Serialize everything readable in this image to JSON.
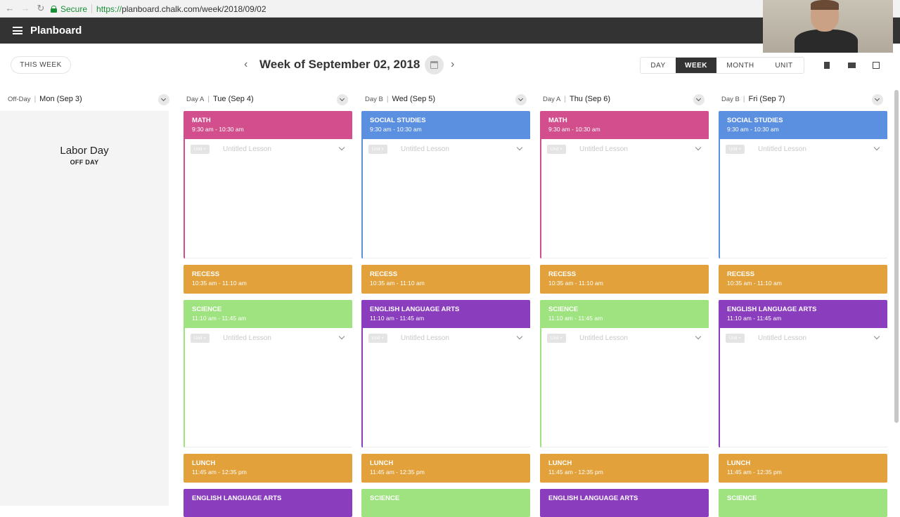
{
  "browser": {
    "secure_label": "Secure",
    "url_protocol": "https://",
    "url_rest": "planboard.chalk.com/week/2018/09/02"
  },
  "app": {
    "name": "Planboard"
  },
  "toolbar": {
    "this_week": "THIS WEEK",
    "title": "Week of September 02, 2018",
    "views": [
      "DAY",
      "WEEK",
      "MONTH",
      "UNIT"
    ],
    "active_view": "WEEK"
  },
  "days": [
    {
      "rotation": "Off-Day",
      "name": "Mon (Sep 3)"
    },
    {
      "rotation": "Day A",
      "name": "Tue (Sep 4)"
    },
    {
      "rotation": "Day B",
      "name": "Wed (Sep 5)"
    },
    {
      "rotation": "Day A",
      "name": "Thu (Sep 6)"
    },
    {
      "rotation": "Day B",
      "name": "Fri (Sep 7)"
    }
  ],
  "off_day": {
    "title": "Labor Day",
    "subtitle": "OFF DAY"
  },
  "lesson_placeholder": "Untitled Lesson",
  "unit_chip": "Unit +",
  "colors": {
    "math": "#d24e8c",
    "social_studies": "#5b8fe0",
    "recess": "#e2a13a",
    "science": "#9ee37f",
    "ela": "#8a3dbd",
    "lunch": "#e2a13a"
  },
  "columns": [
    {
      "blocks": [
        {
          "name": "MATH",
          "time": "9:30 am - 10:30 am",
          "color": "math"
        },
        {
          "name": "RECESS",
          "time": "10:35 am - 11:10 am",
          "color": "recess"
        },
        {
          "name": "SCIENCE",
          "time": "11:10 am - 11:45 am",
          "color": "science"
        },
        {
          "name": "LUNCH",
          "time": "11:45 am - 12:35 pm",
          "color": "lunch"
        },
        {
          "name": "ENGLISH LANGUAGE ARTS",
          "time": "",
          "color": "ela"
        }
      ]
    },
    {
      "blocks": [
        {
          "name": "SOCIAL STUDIES",
          "time": "9:30 am - 10:30 am",
          "color": "social_studies"
        },
        {
          "name": "RECESS",
          "time": "10:35 am - 11:10 am",
          "color": "recess"
        },
        {
          "name": "ENGLISH LANGUAGE ARTS",
          "time": "11:10 am - 11:45 am",
          "color": "ela"
        },
        {
          "name": "LUNCH",
          "time": "11:45 am - 12:35 pm",
          "color": "lunch"
        },
        {
          "name": "SCIENCE",
          "time": "",
          "color": "science"
        }
      ]
    },
    {
      "blocks": [
        {
          "name": "MATH",
          "time": "9:30 am - 10:30 am",
          "color": "math"
        },
        {
          "name": "RECESS",
          "time": "10:35 am - 11:10 am",
          "color": "recess"
        },
        {
          "name": "SCIENCE",
          "time": "11:10 am - 11:45 am",
          "color": "science"
        },
        {
          "name": "LUNCH",
          "time": "11:45 am - 12:35 pm",
          "color": "lunch"
        },
        {
          "name": "ENGLISH LANGUAGE ARTS",
          "time": "",
          "color": "ela"
        }
      ]
    },
    {
      "blocks": [
        {
          "name": "SOCIAL STUDIES",
          "time": "9:30 am - 10:30 am",
          "color": "social_studies"
        },
        {
          "name": "RECESS",
          "time": "10:35 am - 11:10 am",
          "color": "recess"
        },
        {
          "name": "ENGLISH LANGUAGE ARTS",
          "time": "11:10 am - 11:45 am",
          "color": "ela"
        },
        {
          "name": "LUNCH",
          "time": "11:45 am - 12:35 pm",
          "color": "lunch"
        },
        {
          "name": "SCIENCE",
          "time": "",
          "color": "science"
        }
      ]
    }
  ]
}
